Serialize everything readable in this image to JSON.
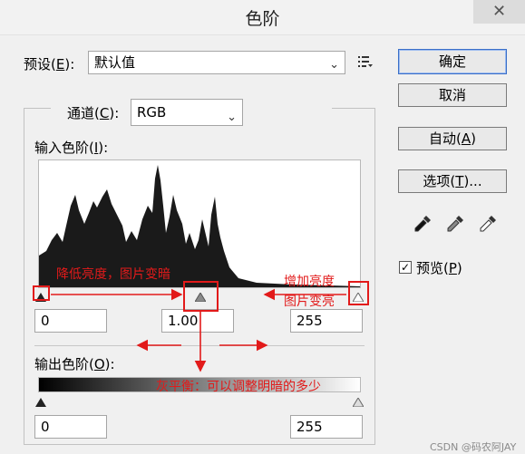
{
  "window": {
    "title": "色阶",
    "close_glyph": "✕"
  },
  "preset": {
    "label_pre": "预设(",
    "label_key": "E",
    "label_post": "):",
    "value": "默认值"
  },
  "buttons": {
    "ok": {
      "pre": "",
      "key": "",
      "post": "确定"
    },
    "cancel": {
      "pre": "",
      "key": "",
      "post": "取消"
    },
    "auto": {
      "pre": "自动(",
      "key": "A",
      "post": ")"
    },
    "options": {
      "pre": "选项(",
      "key": "T",
      "post": ")..."
    }
  },
  "channel": {
    "label_pre": "通道(",
    "label_key": "C",
    "label_post": "):",
    "value": "RGB"
  },
  "input_levels": {
    "label_pre": "输入色阶(",
    "label_key": "I",
    "label_post": "):",
    "black": "0",
    "gamma": "1.00",
    "white": "255"
  },
  "output_levels": {
    "label_pre": "输出色阶(",
    "label_key": "O",
    "label_post": "):",
    "black": "0",
    "white": "255"
  },
  "preview": {
    "pre": "预览(",
    "key": "P",
    "post": ")",
    "checked": true
  },
  "annotations": {
    "darken": "降低亮度，图片变暗",
    "brighten_1": "增加亮度",
    "brighten_2": "图片变亮",
    "balance": "灰平衡：可以调整明暗的多少"
  },
  "watermark": "CSDN @码农阿JAY",
  "colors": {
    "annotation_red": "#e21a1a",
    "histogram": "#1a1a1a",
    "default_button_border": "#3a6fc8"
  },
  "icons": [
    "options-menu-icon",
    "black-eyedropper-icon",
    "gray-eyedropper-icon",
    "white-eyedropper-icon"
  ]
}
